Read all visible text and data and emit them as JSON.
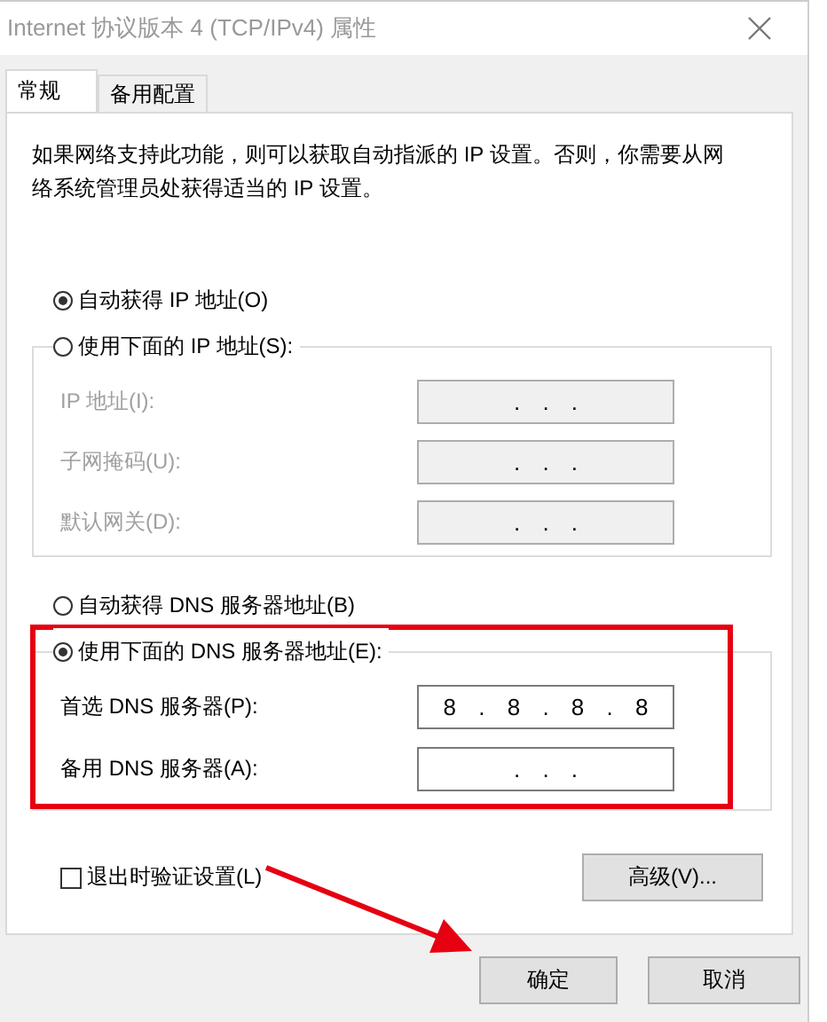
{
  "window": {
    "title": "Internet 协议版本 4 (TCP/IPv4) 属性"
  },
  "tabs": [
    {
      "label": "常规",
      "selected": true
    },
    {
      "label": "备用配置",
      "selected": false
    }
  ],
  "description": "如果网络支持此功能，则可以获取自动指派的 IP 设置。否则，你需要从网络系统管理员处获得适当的 IP 设置。",
  "ip": {
    "options": [
      {
        "label": "自动获得 IP 地址(O)",
        "selected": true
      },
      {
        "label": "使用下面的 IP 地址(S):",
        "selected": false
      }
    ],
    "fields": [
      {
        "label": "IP 地址(I):",
        "value": ". . .",
        "disabled": true
      },
      {
        "label": "子网掩码(U):",
        "value": ". . .",
        "disabled": true
      },
      {
        "label": "默认网关(D):",
        "value": ". . .",
        "disabled": true
      }
    ]
  },
  "dns": {
    "options": [
      {
        "label": "自动获得 DNS 服务器地址(B)",
        "selected": false
      },
      {
        "label": "使用下面的 DNS 服务器地址(E):",
        "selected": true
      }
    ],
    "fields": [
      {
        "label": "首选 DNS 服务器(P):",
        "value": "8 . 8 . 8 . 8",
        "disabled": false
      },
      {
        "label": "备用 DNS 服务器(A):",
        "value": ". . .",
        "disabled": false
      }
    ]
  },
  "validate": {
    "label": "退出时验证设置(L)",
    "checked": false
  },
  "advanced_button": "高级(V)...",
  "buttons": [
    "确定",
    "取消"
  ]
}
